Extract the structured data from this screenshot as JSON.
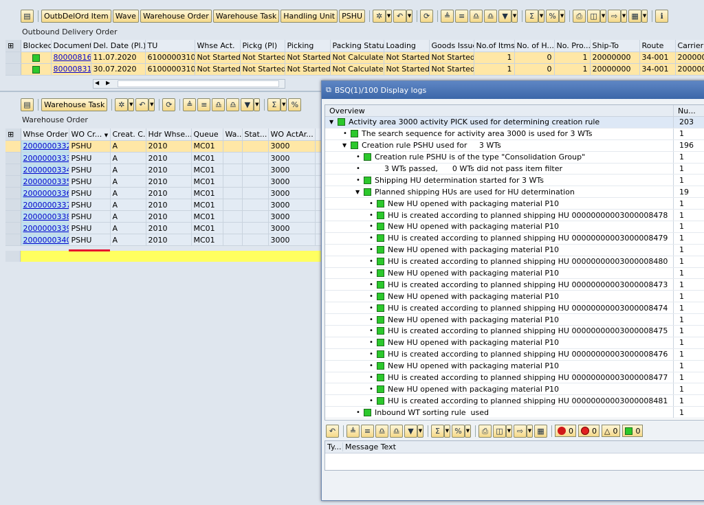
{
  "top_toolbar": {
    "buttons": [
      "OutbDelOrd Item",
      "Wave",
      "Warehouse Order",
      "Warehouse Task",
      "Handling Unit",
      "PSHU"
    ]
  },
  "odo": {
    "title": "Outbound Delivery Order",
    "columns": [
      "Blocked",
      "Document",
      "Del. Date (Pl.)",
      "TU",
      "Whse Act.",
      "Pickg (Pl)",
      "Picking",
      "Packing Status",
      "Loading",
      "Goods Issue",
      "No.of Itms",
      "No. of H...",
      "No. Pro...",
      "Ship-To",
      "Route",
      "Carrier"
    ],
    "rows": [
      {
        "document": "80000816",
        "date": "11.07.2020",
        "tu": "6100000310",
        "whse_act": "Not Started",
        "pickg_pl": "Not Started",
        "picking": "Not Started",
        "packing": "Not Calculated",
        "loading": "Not Started",
        "goods_issue": "Not Started",
        "items": "1",
        "no_h": "0",
        "no_pro": "1",
        "ship_to": "20000000",
        "route": "34-001",
        "carrier": "200000"
      },
      {
        "document": "80000831",
        "date": "30.07.2020",
        "tu": "6100000310",
        "whse_act": "Not Started",
        "pickg_pl": "Not Started",
        "picking": "Not Started",
        "packing": "Not Calculated",
        "loading": "Not Started",
        "goods_issue": "Not Started",
        "items": "1",
        "no_h": "0",
        "no_pro": "1",
        "ship_to": "20000000",
        "route": "34-001",
        "carrier": "200000"
      }
    ]
  },
  "wo_toolbar": {
    "button": "Warehouse Task"
  },
  "wo": {
    "title": "Warehouse Order",
    "columns": [
      "Whse Order",
      "WO Cr...",
      "Creat. C...",
      "Hdr Whse...",
      "Queue",
      "Wa...",
      "Stat...",
      "WO ActAr..."
    ],
    "rows": [
      {
        "order": "2000000332",
        "wocr": "PSHU",
        "creat": "A",
        "hdr": "2010",
        "queue": "MC01",
        "act": "3000"
      },
      {
        "order": "2000000333",
        "wocr": "PSHU",
        "creat": "A",
        "hdr": "2010",
        "queue": "MC01",
        "act": "3000"
      },
      {
        "order": "2000000334",
        "wocr": "PSHU",
        "creat": "A",
        "hdr": "2010",
        "queue": "MC01",
        "act": "3000"
      },
      {
        "order": "2000000335",
        "wocr": "PSHU",
        "creat": "A",
        "hdr": "2010",
        "queue": "MC01",
        "act": "3000"
      },
      {
        "order": "2000000336",
        "wocr": "PSHU",
        "creat": "A",
        "hdr": "2010",
        "queue": "MC01",
        "act": "3000"
      },
      {
        "order": "2000000337",
        "wocr": "PSHU",
        "creat": "A",
        "hdr": "2010",
        "queue": "MC01",
        "act": "3000"
      },
      {
        "order": "2000000338",
        "wocr": "PSHU",
        "creat": "A",
        "hdr": "2010",
        "queue": "MC01",
        "act": "3000"
      },
      {
        "order": "2000000339",
        "wocr": "PSHU",
        "creat": "A",
        "hdr": "2010",
        "queue": "MC01",
        "act": "3000"
      },
      {
        "order": "2000000340",
        "wocr": "PSHU",
        "creat": "A",
        "hdr": "2010",
        "queue": "MC01",
        "act": "3000"
      }
    ]
  },
  "popup": {
    "title": "BSQ(1)/100 Display logs",
    "overview_header": "Overview",
    "count_header": "Nu...",
    "rows": [
      {
        "level": 0,
        "node": "open",
        "text": "Activity area 3000 activity PICK used for determining creation rule",
        "count": "203"
      },
      {
        "level": 1,
        "node": "leaf",
        "text": "The search sequence for activity area 3000 is used for 3 WTs",
        "count": "1"
      },
      {
        "level": 1,
        "node": "open",
        "text": "Creation rule PSHU used for     3 WTs",
        "count": "196"
      },
      {
        "level": 2,
        "node": "leaf",
        "text": "Creation rule PSHU is of the type \"Consolidation Group\"",
        "count": "1"
      },
      {
        "level": 2,
        "node": "leaf",
        "nobox": true,
        "text": "    3 WTs passed,      0 WTs did not pass item filter",
        "count": "1"
      },
      {
        "level": 2,
        "node": "leaf",
        "text": "Shipping HU determination started for 3 WTs",
        "count": "1"
      },
      {
        "level": 2,
        "node": "open",
        "text": "Planned shipping HUs are used for HU determination",
        "count": "19"
      },
      {
        "level": 3,
        "node": "leaf",
        "text": "New HU opened with packaging material P10",
        "count": "1"
      },
      {
        "level": 3,
        "node": "leaf",
        "text": "HU is created according to planned shipping HU 00000000003000008478",
        "count": "1"
      },
      {
        "level": 3,
        "node": "leaf",
        "text": "New HU opened with packaging material P10",
        "count": "1"
      },
      {
        "level": 3,
        "node": "leaf",
        "text": "HU is created according to planned shipping HU 00000000003000008479",
        "count": "1"
      },
      {
        "level": 3,
        "node": "leaf",
        "text": "New HU opened with packaging material P10",
        "count": "1"
      },
      {
        "level": 3,
        "node": "leaf",
        "text": "HU is created according to planned shipping HU 00000000003000008480",
        "count": "1"
      },
      {
        "level": 3,
        "node": "leaf",
        "text": "New HU opened with packaging material P10",
        "count": "1"
      },
      {
        "level": 3,
        "node": "leaf",
        "text": "HU is created according to planned shipping HU 00000000003000008473",
        "count": "1"
      },
      {
        "level": 3,
        "node": "leaf",
        "text": "New HU opened with packaging material P10",
        "count": "1"
      },
      {
        "level": 3,
        "node": "leaf",
        "text": "HU is created according to planned shipping HU 00000000003000008474",
        "count": "1"
      },
      {
        "level": 3,
        "node": "leaf",
        "text": "New HU opened with packaging material P10",
        "count": "1"
      },
      {
        "level": 3,
        "node": "leaf",
        "text": "HU is created according to planned shipping HU 00000000003000008475",
        "count": "1"
      },
      {
        "level": 3,
        "node": "leaf",
        "text": "New HU opened with packaging material P10",
        "count": "1"
      },
      {
        "level": 3,
        "node": "leaf",
        "text": "HU is created according to planned shipping HU 00000000003000008476",
        "count": "1"
      },
      {
        "level": 3,
        "node": "leaf",
        "text": "New HU opened with packaging material P10",
        "count": "1"
      },
      {
        "level": 3,
        "node": "leaf",
        "text": "HU is created according to planned shipping HU 00000000003000008477",
        "count": "1"
      },
      {
        "level": 3,
        "node": "leaf",
        "text": "New HU opened with packaging material P10",
        "count": "1"
      },
      {
        "level": 3,
        "node": "leaf",
        "text": "HU is created according to planned shipping HU 00000000003000008481",
        "count": "1"
      },
      {
        "level": 2,
        "node": "leaf",
        "text": "Inbound WT sorting rule  used",
        "count": "1"
      }
    ],
    "status_counts": {
      "stop": "0",
      "error": "0",
      "warning": "0",
      "success": "0"
    },
    "msg_columns": [
      "Ty...",
      "Message Text"
    ]
  },
  "colors": {
    "accent": "#3c67a8",
    "selected_row": "#ffe7a6",
    "success": "#2cc82c"
  }
}
